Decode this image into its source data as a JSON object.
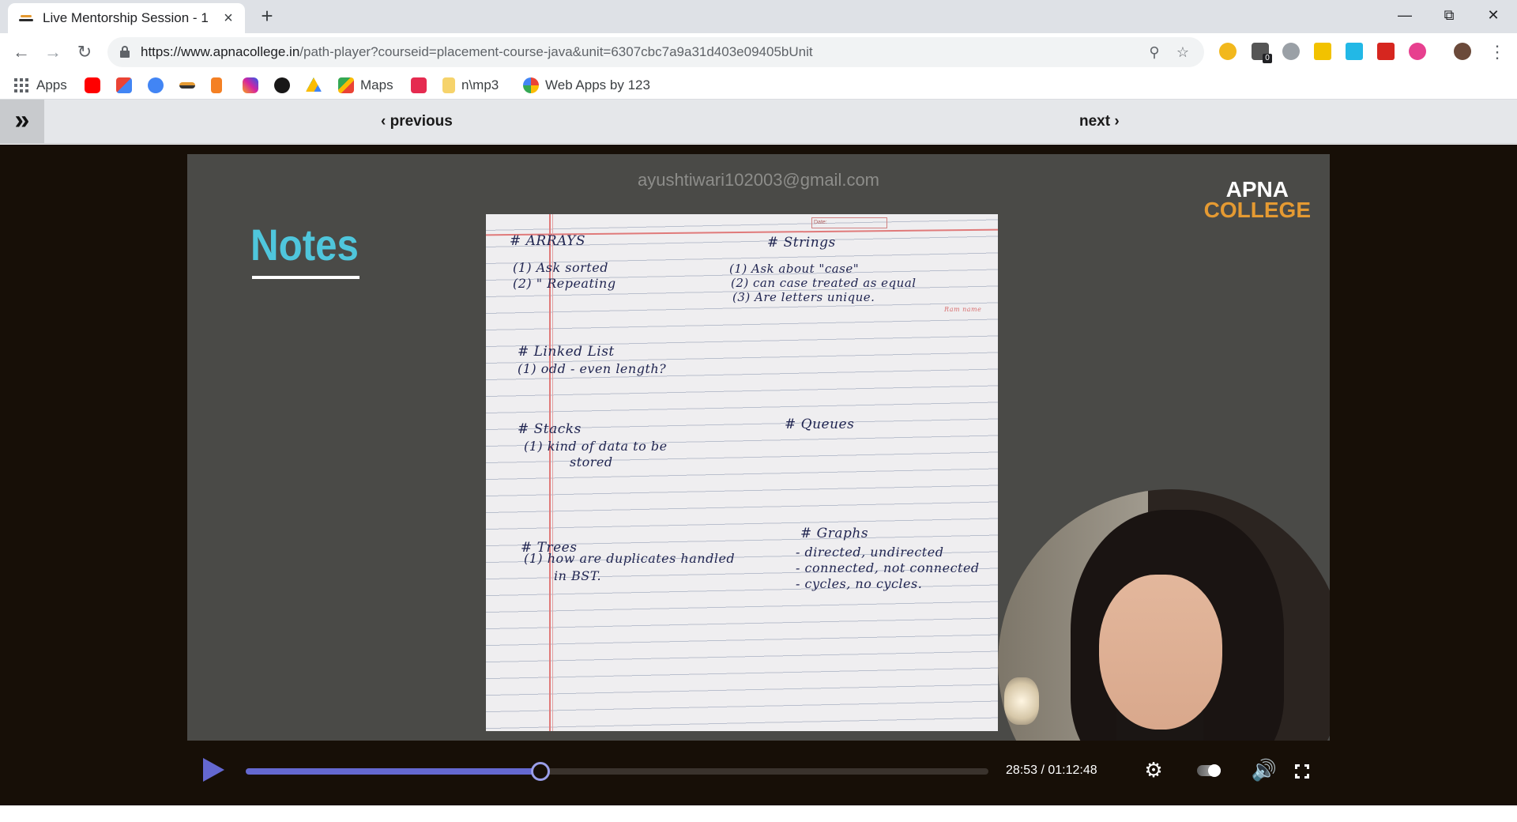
{
  "browser": {
    "tab_title": "Live Mentorship Session - 1",
    "url_host": "https://www.apnacollege.in",
    "url_path": "/path-player?courseid=placement-course-java&unit=6307cbc7a9a31d403e09405bUnit",
    "bookmarks": {
      "apps": "Apps",
      "maps": "Maps",
      "mp3": "n\\mp3",
      "webapps": "Web Apps by 123"
    },
    "extension_badge": "0"
  },
  "page_nav": {
    "previous": "‹ previous",
    "next": "next ›"
  },
  "video": {
    "watermark": "ayushtiwari102003@gmail.com",
    "brand_line1": "APNA",
    "brand_line2": "COLLEGE",
    "slide_title": "Notes",
    "notes": {
      "arrays_h": "# ARRAYS",
      "arrays_1": "(1)  Ask  sorted",
      "arrays_2": "(2)   \"    Repeating",
      "strings_h": "# Strings",
      "strings_1": "(1)  Ask  about \"case\"",
      "strings_2": "(2)  can case treated as equal",
      "strings_3": "(3)  Are letters unique.",
      "ll_h": "# Linked List",
      "ll_1": "(1)  odd - even length?",
      "stacks_h": "# Stacks",
      "stacks_1": "(1)  kind of data to be",
      "stacks_2": "stored",
      "queues_h": "# Queues",
      "trees_h": "# Trees",
      "trees_1": "(1)  how are duplicates handled",
      "trees_2": "in  BST.",
      "graphs_h": "# Graphs",
      "graphs_1": "- directed, undirected",
      "graphs_2": "- connected, not connected",
      "graphs_3": "- cycles, no cycles.",
      "date_label": "Date:",
      "side_note": "Ram name"
    }
  },
  "player": {
    "time": "28:53 / 01:12:48",
    "progress_fraction": 0.3966,
    "accent": "#6468d0"
  },
  "icons": [
    "back-icon",
    "forward-icon",
    "reload-icon",
    "lock-icon",
    "key-icon",
    "star-icon",
    "play-icon",
    "settings-gear-icon",
    "speed-toggle-icon",
    "volume-icon",
    "fullscreen-icon",
    "sidebar-expand-icon"
  ]
}
